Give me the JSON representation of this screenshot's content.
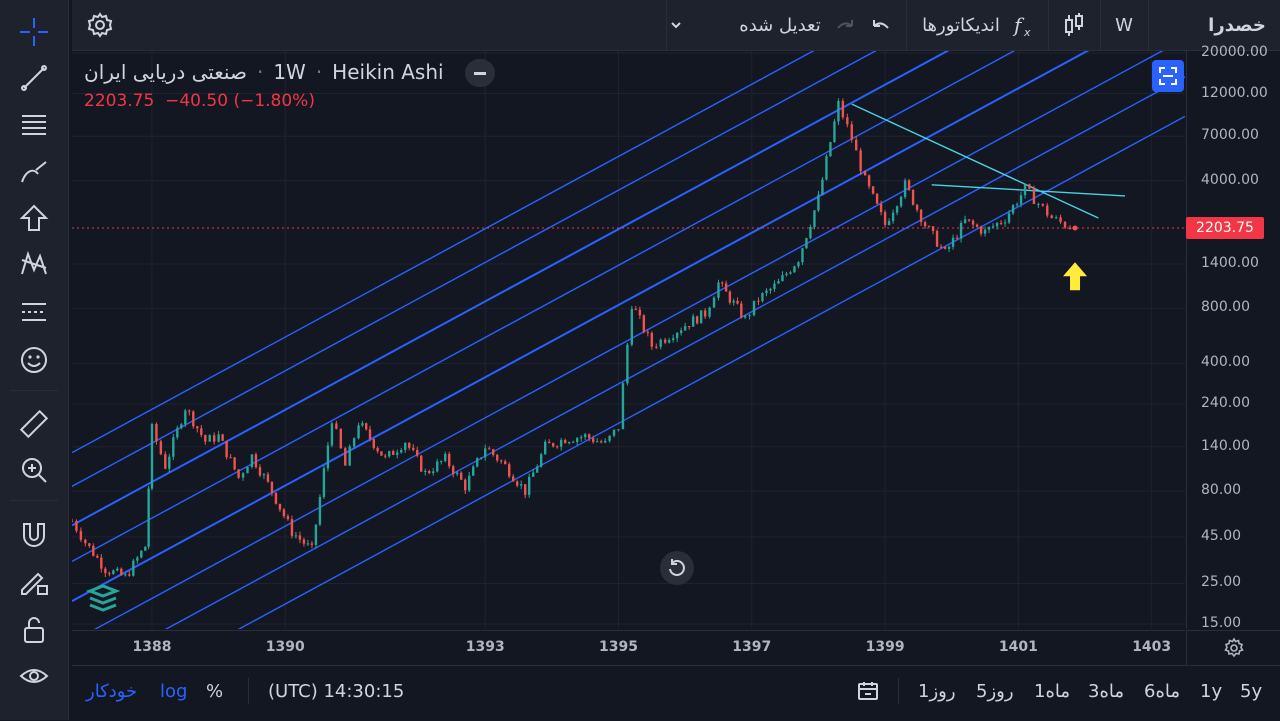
{
  "header": {
    "symbol_fa": "خصدرا",
    "interval": "W",
    "indicators_label": "اندیکاتورها",
    "adjusted_label": "تعدیل شده"
  },
  "legend": {
    "name": "صنعتی دریایی ایران",
    "interval": "1W",
    "chart_style": "Heikin Ashi",
    "last": "2203.75",
    "change": "−40.50",
    "change_pct": "(−1.80%)"
  },
  "last_price_tag": "2203.75",
  "price_axis": {
    "ticks": [
      "20000.00",
      "12000.00",
      "7000.00",
      "4000.00",
      "1400.00",
      "800.00",
      "400.00",
      "240.00",
      "140.00",
      "80.00",
      "45.00",
      "25.00",
      "15.00"
    ]
  },
  "time_axis": {
    "ticks": [
      "1388",
      "1390",
      "1393",
      "1395",
      "1397",
      "1399",
      "1401",
      "1403"
    ]
  },
  "bottom": {
    "auto_label": "خودکار",
    "log_label": "log",
    "pct_label": "%",
    "time": "(UTC) 14:30:15",
    "ranges": [
      "1روز",
      "5روز",
      "1ماه",
      "3ماه",
      "6ماه",
      "1y",
      "5y"
    ]
  },
  "colors": {
    "up": "#26a69a",
    "down": "#ef5350",
    "channel": "#2962ff",
    "trend": "#4dd0e1",
    "arrow": "#ffeb3b",
    "price_line": "#f23645"
  },
  "chart_data": {
    "type": "line",
    "title": "",
    "scale": "log",
    "x_range": [
      1386.8,
      1403.5
    ],
    "y_range": [
      15,
      20000
    ],
    "price_series": {
      "x": [
        1386.8,
        1387.0,
        1387.3,
        1387.6,
        1387.9,
        1388.0,
        1388.2,
        1388.5,
        1388.8,
        1389.0,
        1389.3,
        1389.5,
        1389.8,
        1390.1,
        1390.4,
        1390.7,
        1390.9,
        1391.1,
        1391.5,
        1391.8,
        1392.1,
        1392.4,
        1392.7,
        1393.0,
        1393.3,
        1393.6,
        1393.9,
        1394.2,
        1394.5,
        1394.8,
        1395.0,
        1395.2,
        1395.5,
        1395.7,
        1396.0,
        1396.3,
        1396.5,
        1396.9,
        1397.1,
        1397.4,
        1397.7,
        1398.0,
        1398.3,
        1398.5,
        1398.7,
        1399.0,
        1399.3,
        1399.6,
        1399.9,
        1400.2,
        1400.5,
        1400.8,
        1401.1,
        1401.3,
        1401.5,
        1401.7,
        1401.85
      ],
      "y": [
        55,
        42,
        30,
        27,
        40,
        175,
        110,
        230,
        150,
        160,
        95,
        125,
        80,
        48,
        38,
        200,
        110,
        190,
        120,
        150,
        100,
        120,
        85,
        140,
        110,
        80,
        140,
        155,
        160,
        145,
        180,
        850,
        500,
        550,
        650,
        750,
        1100,
        700,
        900,
        1100,
        1500,
        3200,
        10500,
        6800,
        4000,
        2300,
        3800,
        2300,
        1600,
        2400,
        2100,
        2500,
        3600,
        3000,
        2500,
        2300,
        2203.75
      ]
    },
    "channel_lines": [
      {
        "name": "",
        "x": [
          1386.8,
          1403.5
        ],
        "y": [
          130,
          260000
        ]
      },
      {
        "name": "",
        "x": [
          1386.8,
          1403.5
        ],
        "y": [
          85,
          170000
        ]
      },
      {
        "name": "",
        "x": [
          1386.8,
          1403.5
        ],
        "y": [
          52,
          104000
        ]
      },
      {
        "name": "",
        "x": [
          1386.8,
          1403.5
        ],
        "y": [
          33,
          66000
        ]
      },
      {
        "name": "",
        "x": [
          1386.8,
          1403.5
        ],
        "y": [
          20,
          40000
        ]
      },
      {
        "name": "",
        "x": [
          1386.8,
          1403.5
        ],
        "y": [
          12,
          24000
        ]
      },
      {
        "name": "",
        "x": [
          1386.8,
          1403.5
        ],
        "y": [
          7.4,
          14800
        ]
      },
      {
        "name": "",
        "x": [
          1386.8,
          1403.5
        ],
        "y": [
          4.5,
          9000
        ]
      }
    ],
    "trend_lines": [
      {
        "x": [
          1398.5,
          1402.2
        ],
        "y": [
          10500,
          2500
        ]
      },
      {
        "x": [
          1399.7,
          1402.6
        ],
        "y": [
          3800,
          3300
        ]
      }
    ],
    "annotation_arrow": {
      "x": 1401.85,
      "y": 1200
    }
  }
}
